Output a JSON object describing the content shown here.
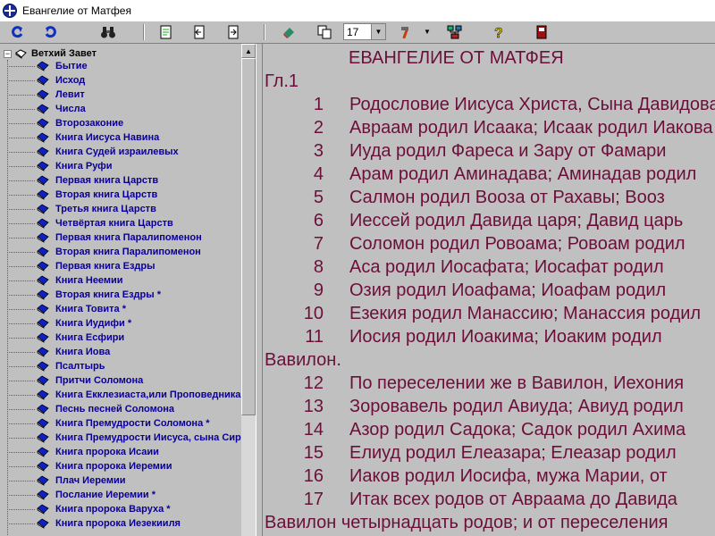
{
  "window": {
    "title": "Евангелие от Матфея"
  },
  "toolbar": {
    "buttons": [
      {
        "name": "back-button",
        "icon": "refresh-left-icon"
      },
      {
        "name": "forward-button",
        "icon": "refresh-right-icon"
      },
      {
        "name": "find-button",
        "icon": "binoculars-icon"
      },
      {
        "name": "document-button",
        "icon": "document-icon"
      },
      {
        "name": "prev-page-button",
        "icon": "page-prev-icon"
      },
      {
        "name": "next-page-button",
        "icon": "page-next-icon"
      },
      {
        "name": "tool-button",
        "icon": "eraser-icon"
      },
      {
        "name": "copy-button",
        "icon": "copy-icon"
      },
      {
        "name": "hammer-button",
        "icon": "hammer-icon"
      },
      {
        "name": "network-button",
        "icon": "network-icon"
      },
      {
        "name": "help-button",
        "icon": "help-icon"
      },
      {
        "name": "exit-button",
        "icon": "exit-icon"
      }
    ],
    "font_size_value": "17"
  },
  "tree": {
    "root_label": "Ветхий Завет",
    "items": [
      "Бытие",
      "Исход",
      "Левит",
      "Числа",
      "Второзаконие",
      "Книга Иисуса Навина",
      "Книга Судей израилевых",
      "Книга Руфи",
      "Первая книга Царств",
      "Вторая книга Царств",
      "Третья книга Царств",
      "Четвёртая книга Царств",
      "Первая книга Паралипоменон",
      "Вторая книга Паралипоменон",
      "Первая книга Ездры",
      "Книга Неемии",
      "Вторая книга Ездры *",
      "Книга Товита *",
      "Книга Иудифи *",
      "Книга Есфири",
      "Книга Иова",
      "Псалтырь",
      "Притчи Соломона",
      "Книга Екклезиаста,или Проповедника",
      "Песнь песней Соломона",
      "Книга Премудрости Соломона *",
      "Книга Премудрости Иисуса, сына Сирахова *",
      "Книга пророка Исаии",
      "Книга пророка Иеремии",
      "Плач Иеремии",
      "Послание Иеремии *",
      "Книга пророка Варуха *",
      "Книга пророка Иезекииля"
    ]
  },
  "text": {
    "book_title": "ЕВАНГЕЛИЕ ОТ МАТФЕЯ",
    "chapter": "Гл.1",
    "verses": [
      {
        "n": "1",
        "t": " Родословие Иисуса Христа, Сына Давидова"
      },
      {
        "n": "2",
        "t": "Авраам родил Исаака; Исаак родил Иакова"
      },
      {
        "n": "3",
        "t": "Иуда родил Фареса и Зару от Фамари"
      },
      {
        "n": "4",
        "t": "Арам родил Аминадава; Аминадав родил"
      },
      {
        "n": "5",
        "t": "Салмон родил Вооза от Рахавы; Вооз"
      },
      {
        "n": "6",
        "t": "Иессей родил Давида царя; Давид царь"
      },
      {
        "n": "7",
        "t": "Соломон родил Ровоама; Ровоам родил"
      },
      {
        "n": "8",
        "t": "Аса родил Иосафата; Иосафат родил"
      },
      {
        "n": "9",
        "t": "Озия родил Иоафама; Иоафам родил"
      },
      {
        "n": "10",
        "t": "Езекия родил Манассию; Манассия родил"
      },
      {
        "n": "11",
        "t": "Иосия родил Иоакима; Иоаким родил"
      }
    ],
    "continuation_1": "Вавилон.",
    "verses_2": [
      {
        "n": "12",
        "t": "По переселении же в Вавилон, Иехония"
      },
      {
        "n": "13",
        "t": "Зоровавель родил Авиуда; Авиуд родил"
      },
      {
        "n": "14",
        "t": "Азор родил Садока; Садок родил Ахима"
      },
      {
        "n": "15",
        "t": "Елиуд родил Елеазара; Елеазар родил"
      },
      {
        "n": "16",
        "t": "Иаков родил Иосифа, мужа Марии, от"
      },
      {
        "n": "17",
        "t": "Итак всех родов от Авраама до Давида"
      }
    ],
    "continuation_2": "Вавилон четырнадцать родов; и от переселения"
  }
}
